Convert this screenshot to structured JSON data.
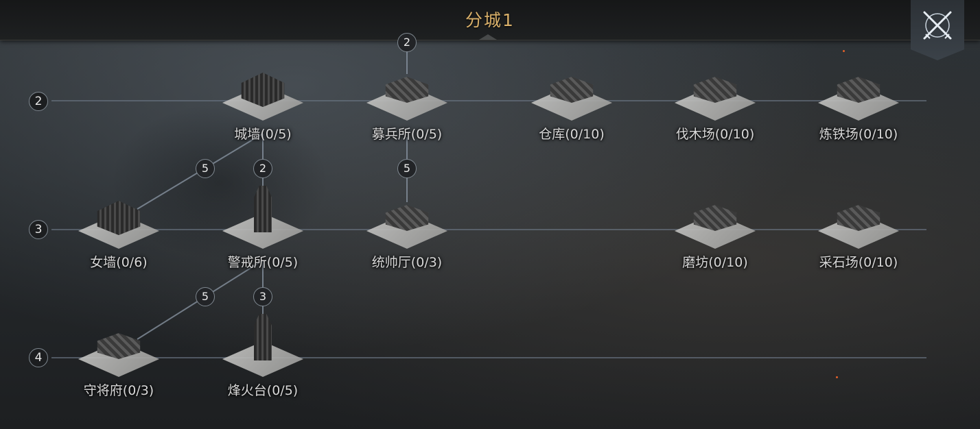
{
  "header": {
    "title": "分城1"
  },
  "tiers": [
    {
      "label": "2"
    },
    {
      "label": "3"
    },
    {
      "label": "4"
    }
  ],
  "buildings": {
    "chengqiang": {
      "name": "城墙(0/5)"
    },
    "mubingsuo": {
      "name": "募兵所(0/5)"
    },
    "cangku": {
      "name": "仓库(0/10)"
    },
    "famuchang": {
      "name": "伐木场(0/10)"
    },
    "liantiechang": {
      "name": "炼铁场(0/10)"
    },
    "nvqiang": {
      "name": "女墙(0/6)"
    },
    "jingjiesuo": {
      "name": "警戒所(0/5)"
    },
    "tongshuaiting": {
      "name": "统帅厅(0/3)"
    },
    "mofang": {
      "name": "磨坊(0/10)"
    },
    "caishichang": {
      "name": "采石场(0/10)"
    },
    "shoujiangfu": {
      "name": "守将府(0/3)"
    },
    "fenghuotai": {
      "name": "烽火台(0/5)"
    }
  },
  "requirements": {
    "mubingsuo_top": "2",
    "nvqiang_from_chengqiang": "5",
    "jingjiesuo_from_chengqiang": "2",
    "tongshuaiting_from_mubingsuo": "5",
    "shoujiangfu_from_jingjiesuo": "5",
    "fenghuotai_from_jingjiesuo": "3"
  },
  "icons": {
    "close": "crossed-swords-icon"
  }
}
